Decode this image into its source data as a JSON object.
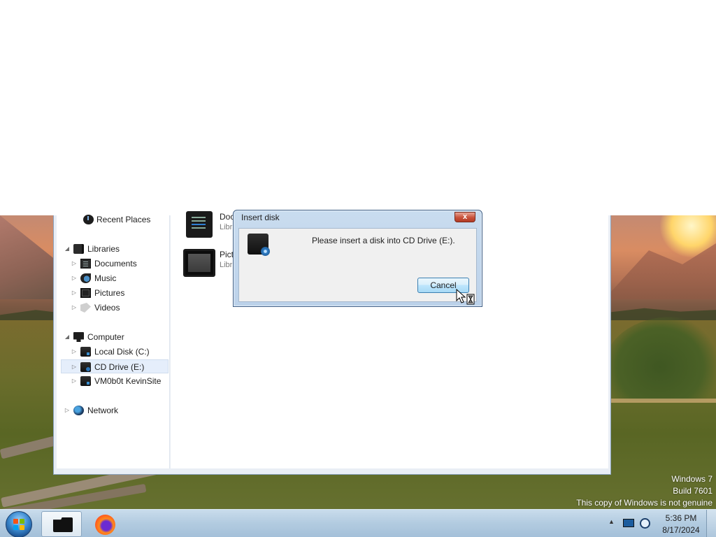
{
  "nav": {
    "recent_places": "Recent Places",
    "libraries": "Libraries",
    "documents": "Documents",
    "music": "Music",
    "pictures": "Pictures",
    "videos": "Videos",
    "computer": "Computer",
    "local_disk": "Local Disk (C:)",
    "cd_drive": "CD Drive (E:)",
    "network_drive": "VM0b0t KevinSite",
    "network": "Network"
  },
  "content": {
    "items": [
      {
        "name": "Doc",
        "sub": "Libr"
      },
      {
        "name": "Pict",
        "sub": "Libr"
      }
    ]
  },
  "dialog": {
    "title": "Insert disk",
    "message": "Please insert a disk into CD Drive (E:).",
    "cancel_label": "Cancel",
    "close_glyph": "x"
  },
  "watermark": {
    "line1": "Windows 7",
    "line2": "Build 7601",
    "line3": "This copy of Windows is not genuine"
  },
  "taskbar": {
    "time": "5:36 PM",
    "date": "8/17/2024",
    "tray_arrow": "▲"
  },
  "icons": {
    "start": "windows-start-orb",
    "explorer": "folder-icon",
    "firefox": "firefox-icon",
    "cursor": "busy-cursor-icon"
  }
}
